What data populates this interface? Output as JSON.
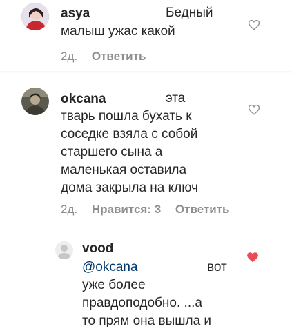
{
  "comments": [
    {
      "username": "asya",
      "text_line1": "Бедный",
      "text_line2": "малыш ужас какой",
      "time": "2д.",
      "likes": "",
      "reply_label": "Ответить",
      "heart": "heart-outline-icon",
      "liked": false
    },
    {
      "username": "okcana",
      "text_line1": "эта",
      "text_rest": "тварь пошла бухать к\nсоседке взяла с собой\nстаршего сына а\nмаленькая оставила\nдома закрыла на ключ",
      "time": "2д.",
      "likes": "Нравится: 3",
      "reply_label": "Ответить",
      "heart": "heart-outline-icon",
      "liked": false
    },
    {
      "username": "vood",
      "mention": "@okcana",
      "text_line1": "вот",
      "text_rest": "уже более\nправдоподобно. ...а\nто прям она вышла и",
      "heart": "heart-filled-icon",
      "liked": true
    }
  ],
  "colors": {
    "text": "#262626",
    "meta": "#8e8e8e",
    "mention": "#00376b",
    "like": "#ed4956"
  }
}
